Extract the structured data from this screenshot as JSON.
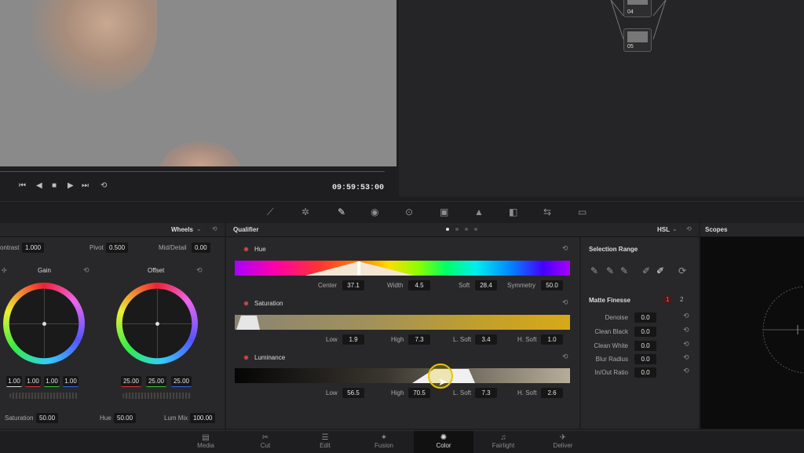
{
  "viewer": {
    "timecode": "09:59:53:00"
  },
  "nodes": [
    {
      "label": "04"
    },
    {
      "label": "05"
    }
  ],
  "wheels_panel": {
    "title": "Wheels",
    "contrast_label": "ontrast",
    "contrast": "1.000",
    "pivot_label": "Pivot",
    "pivot": "0.500",
    "middetail_label": "Mid/Detail",
    "middetail": "0.00",
    "gain": {
      "title": "Gain",
      "values": [
        "1.00",
        "1.00",
        "1.00",
        "1.00"
      ]
    },
    "offset": {
      "title": "Offset",
      "values": [
        "25.00",
        "25.00",
        "25.00"
      ]
    },
    "saturation_label": "Saturation",
    "saturation": "50.00",
    "hue_label": "Hue",
    "hue": "50.00",
    "lummix_label": "Lum Mix",
    "lummix": "100.00"
  },
  "qualifier": {
    "title": "Qualifier",
    "mode": "HSL",
    "hue": {
      "label": "Hue",
      "center_label": "Center",
      "center": "37.1",
      "width_label": "Width",
      "width": "4.5",
      "soft_label": "Soft",
      "soft": "28.4",
      "symmetry_label": "Symmetry",
      "symmetry": "50.0"
    },
    "saturation": {
      "label": "Saturation",
      "low_label": "Low",
      "low": "1.9",
      "high_label": "High",
      "high": "7.3",
      "lsoft_label": "L. Soft",
      "lsoft": "3.4",
      "hsoft_label": "H. Soft",
      "hsoft": "1.0"
    },
    "luminance": {
      "label": "Luminance",
      "low_label": "Low",
      "low": "56.5",
      "high_label": "High",
      "high": "70.5",
      "lsoft_label": "L. Soft",
      "lsoft": "7.3",
      "hsoft_label": "H. Soft",
      "hsoft": "2.6"
    }
  },
  "selection_range": {
    "title": "Selection Range"
  },
  "matte_finesse": {
    "title": "Matte Finesse",
    "tab1": "1",
    "tab2": "2",
    "rows": [
      {
        "label": "Denoise",
        "value": "0.0"
      },
      {
        "label": "Clean Black",
        "value": "0.0"
      },
      {
        "label": "Clean White",
        "value": "0.0"
      },
      {
        "label": "Blur Radius",
        "value": "0.0"
      },
      {
        "label": "In/Out Ratio",
        "value": "0.0"
      }
    ]
  },
  "scopes": {
    "title": "Scopes"
  },
  "nav": [
    {
      "label": "Media",
      "icon": "media-icon"
    },
    {
      "label": "Cut",
      "icon": "cut-icon"
    },
    {
      "label": "Edit",
      "icon": "edit-icon"
    },
    {
      "label": "Fusion",
      "icon": "fusion-icon"
    },
    {
      "label": "Color",
      "icon": "color-icon"
    },
    {
      "label": "Fairlight",
      "icon": "fairlight-icon"
    },
    {
      "label": "Deliver",
      "icon": "deliver-icon"
    }
  ],
  "colors": {
    "accent": "#e6c400",
    "hue_handle": "#f4e6d4"
  }
}
